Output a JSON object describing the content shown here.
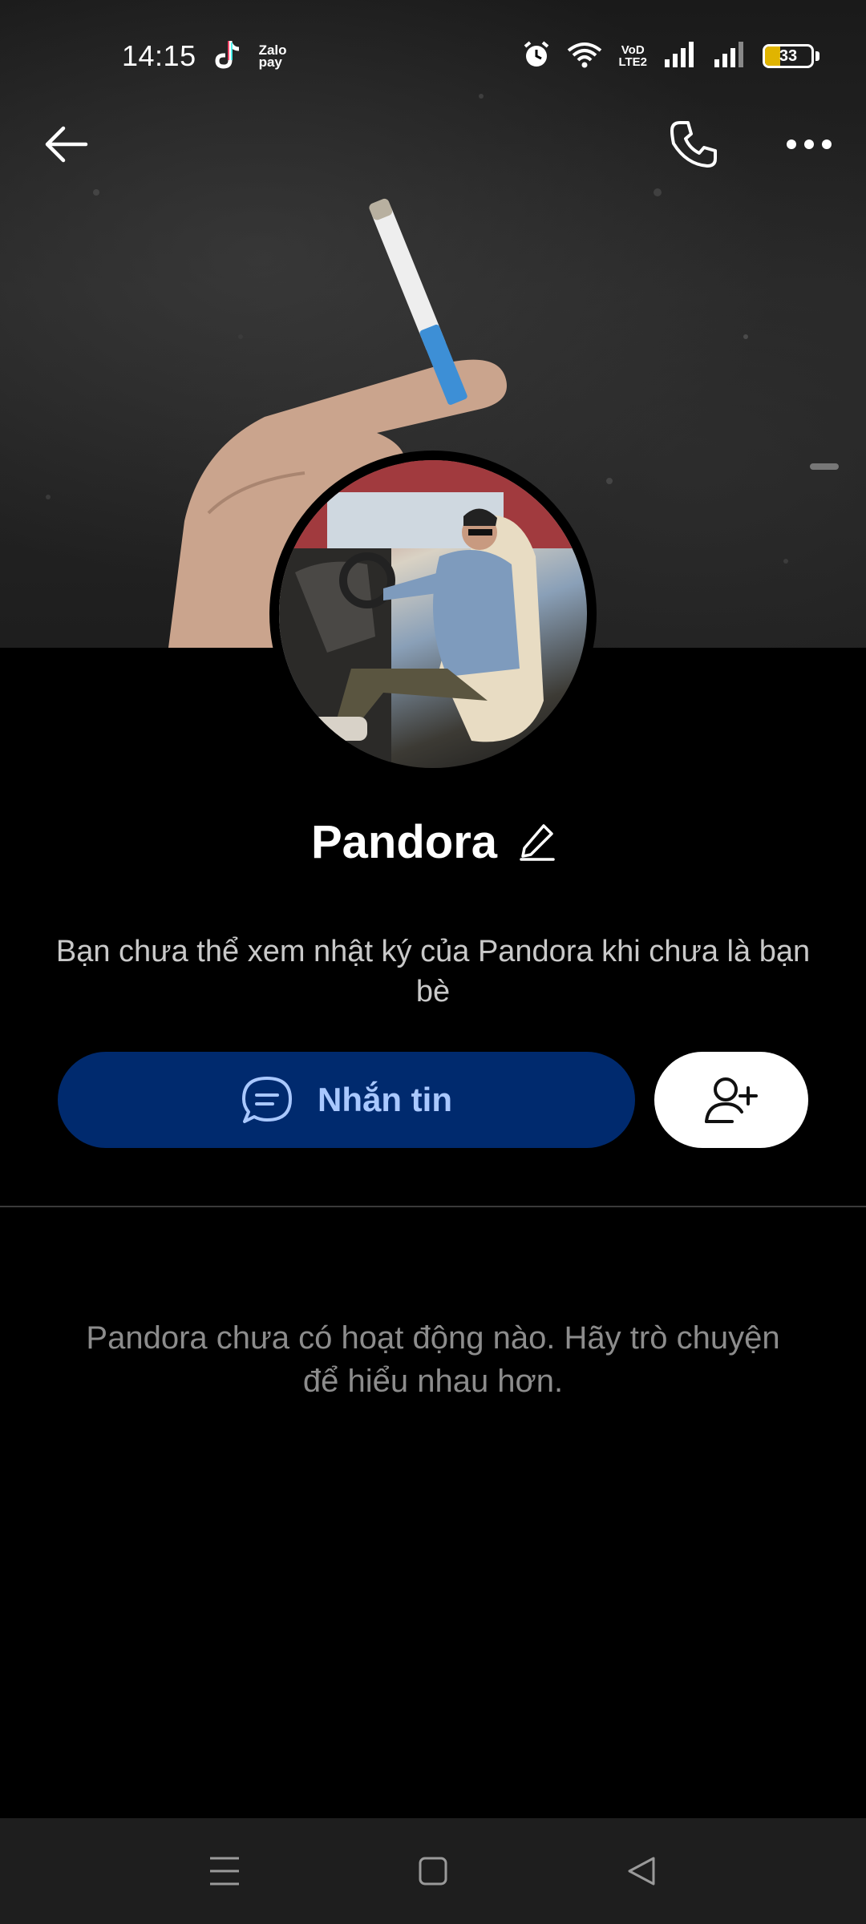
{
  "status_bar": {
    "time": "14:15",
    "zalopay_label": "Zalo\npay",
    "volte_label": "VoD\nLTE2",
    "battery_percent": 33,
    "battery_text": "33",
    "icons": [
      "tiktok-icon",
      "zalopay-icon",
      "alarm-icon",
      "wifi-icon",
      "volte-icon",
      "signal-icon",
      "signal-icon",
      "battery-icon"
    ]
  },
  "header": {
    "icons": [
      "back-arrow-icon",
      "phone-icon",
      "more-dots-icon"
    ]
  },
  "profile": {
    "name": "Pandora",
    "notice": "Bạn chưa thể xem nhật ký của Pandora khi chưa là bạn bè"
  },
  "actions": {
    "message_label": "Nhắn tin",
    "message_icon": "chat-bubble-icon",
    "add_friend_icon": "add-user-icon"
  },
  "empty_state": {
    "message": "Pandora chưa có hoạt động nào. Hãy trò chuyện để hiểu nhau hơn."
  },
  "nav_bar": {
    "icons": [
      "menu-icon",
      "home-square-icon",
      "back-triangle-icon"
    ]
  },
  "colors": {
    "background": "#000000",
    "message_button_bg": "#002a6e",
    "message_button_text": "#a9c8ff",
    "nav_bar_bg": "#1e1e1e",
    "battery_fill": "#e0b400"
  }
}
